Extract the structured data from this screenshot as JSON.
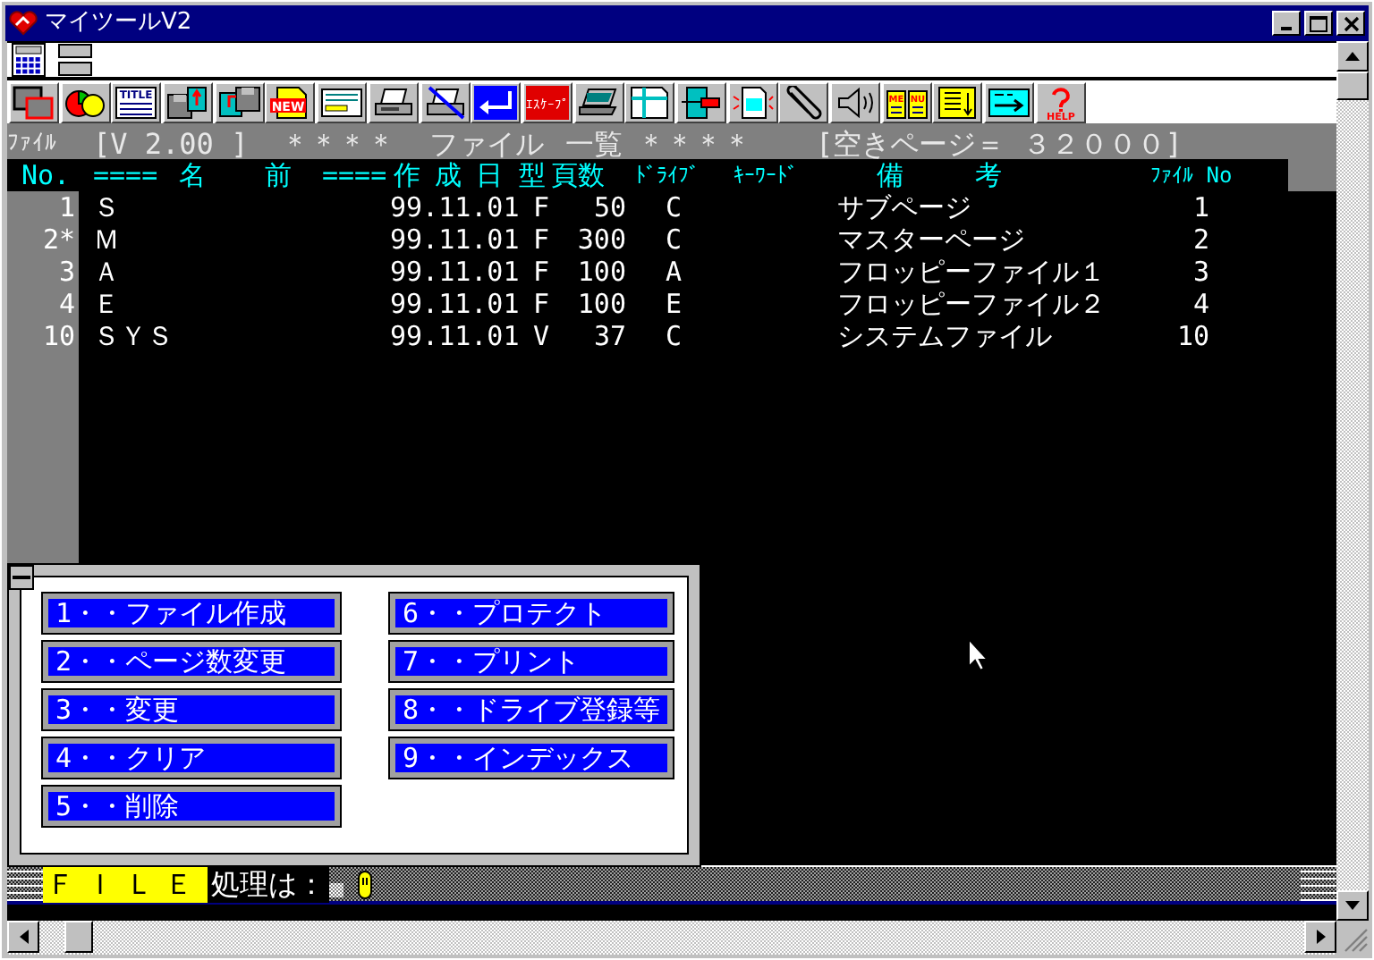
{
  "window": {
    "title": "マイツールV2"
  },
  "quick_bar": [
    {
      "kind": "calculator"
    },
    {
      "kind": "stack"
    }
  ],
  "toolbar": [
    {
      "kind": "windows"
    },
    {
      "kind": "pie"
    },
    {
      "kind": "title",
      "label": "TITLE"
    },
    {
      "kind": "disk_up"
    },
    {
      "kind": "disk_left"
    },
    {
      "kind": "new",
      "label": "NEW"
    },
    {
      "kind": "card"
    },
    {
      "kind": "printer"
    },
    {
      "kind": "printer_x"
    },
    {
      "kind": "enter"
    },
    {
      "kind": "escape",
      "label": "ｴｽｹｰﾌﾟ"
    },
    {
      "kind": "laptop"
    },
    {
      "kind": "grid"
    },
    {
      "kind": "transfer"
    },
    {
      "kind": "page"
    },
    {
      "kind": "clip"
    },
    {
      "kind": "speaker"
    },
    {
      "kind": "book",
      "labels": [
        "ME",
        "NU"
      ]
    },
    {
      "kind": "list"
    },
    {
      "kind": "arrow"
    },
    {
      "kind": "help",
      "label": "HELP"
    }
  ],
  "header": [
    "ﾌｧｲﾙ",
    "[V 2.00 ]",
    "＊＊＊＊",
    "ファイル",
    "一覧",
    "＊＊＊＊",
    "[空きページ＝ ３２０００]"
  ],
  "columns": [
    "No.",
    "====",
    "名",
    "前",
    "====",
    "作",
    "成",
    "日",
    "型",
    "頁数",
    "ﾄﾞﾗｲﾌﾞ",
    "ｷｰﾜｰﾄﾞ",
    "備",
    "考",
    "ﾌｧｲﾙ No"
  ],
  "rows": [
    {
      "no": "1",
      "name": "Ｓ",
      "date": "99.11.01",
      "type": "F",
      "pages": "50",
      "drive": "C",
      "remark": "サブページ",
      "file_no": "1"
    },
    {
      "no": "2*",
      "name": "Ｍ",
      "date": "99.11.01",
      "type": "F",
      "pages": "300",
      "drive": "C",
      "remark": "マスターページ",
      "file_no": "2"
    },
    {
      "no": "3",
      "name": "Ａ",
      "date": "99.11.01",
      "type": "F",
      "pages": "100",
      "drive": "A",
      "remark": "フロッピーファイル１",
      "file_no": "3"
    },
    {
      "no": "4",
      "name": "Ｅ",
      "date": "99.11.01",
      "type": "F",
      "pages": "100",
      "drive": "E",
      "remark": "フロッピーファイル２",
      "file_no": "4"
    },
    {
      "no": "10",
      "name": "ＳＹＳ",
      "date": "99.11.01",
      "type": "V",
      "pages": "37",
      "drive": "C",
      "remark": "システムファイル",
      "file_no": "10"
    }
  ],
  "menu": {
    "left": [
      "1・・ファイル作成",
      "2・・ページ数変更",
      "3・・変更",
      "4・・クリア",
      "5・・削除"
    ],
    "right": [
      "6・・プロテクト",
      "7・・プリント",
      "8・・ドライブ登録等",
      "9・・インデックス"
    ]
  },
  "status_bar": {
    "mode": "ＦＩＬＥ",
    "prompt": "処理は："
  }
}
